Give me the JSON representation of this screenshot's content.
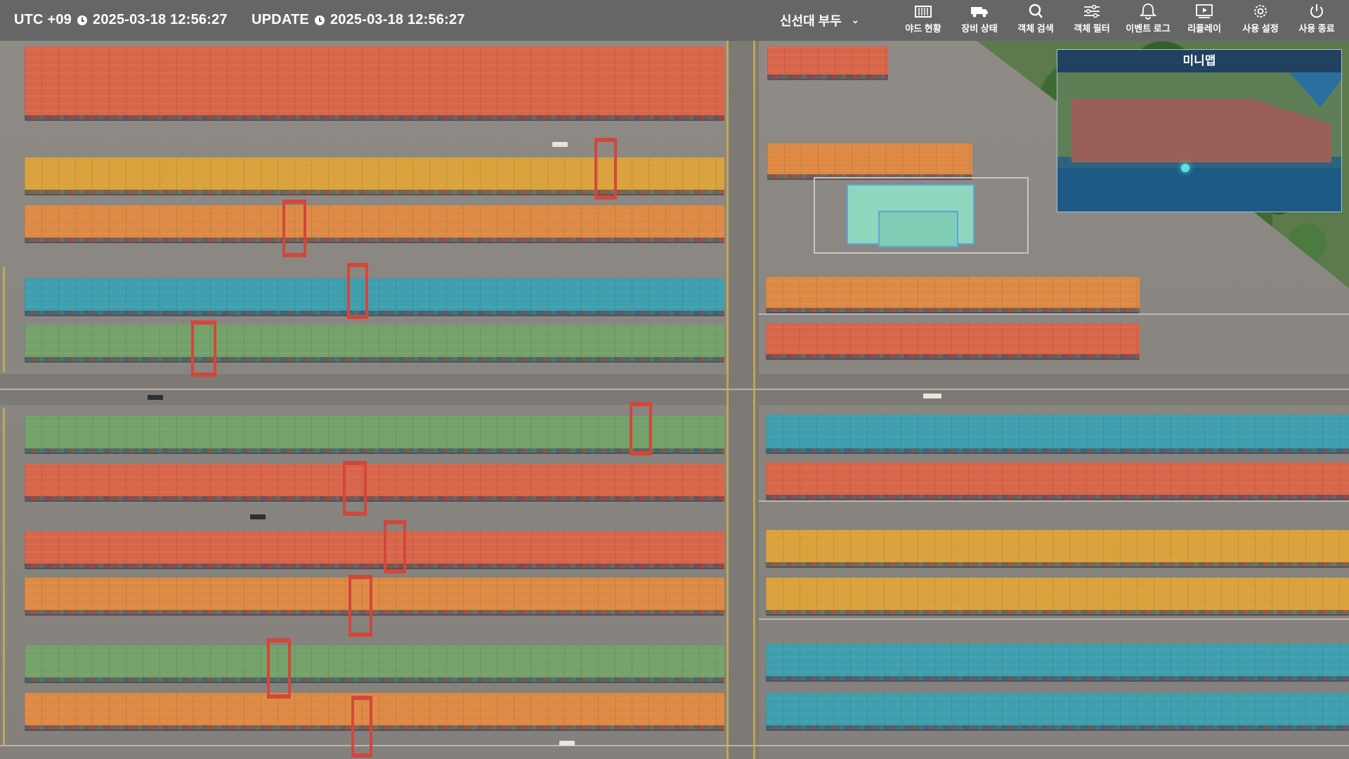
{
  "header": {
    "utc_label": "UTC +09",
    "utc_time": "2025-03-18 12:56:27",
    "update_label": "UPDATE",
    "update_time": "2025-03-18 12:56:27",
    "terminal_selected": "신선대 부두"
  },
  "nav": [
    {
      "label": "야드 현황",
      "icon": "container-icon"
    },
    {
      "label": "장비 상태",
      "icon": "truck-icon"
    },
    {
      "label": "객체 검색",
      "icon": "search-icon"
    },
    {
      "label": "객체 필터",
      "icon": "filter-sliders-icon"
    },
    {
      "label": "이벤트 로그",
      "icon": "bell-icon"
    },
    {
      "label": "리플레이",
      "icon": "replay-icon"
    },
    {
      "label": "사용 설정",
      "icon": "gear-icon"
    },
    {
      "label": "사용 종료",
      "icon": "power-icon"
    }
  ],
  "minimap": {
    "title": "미니맵"
  },
  "colors": {
    "red": "#d8664a",
    "orange": "#de8a45",
    "yellow": "#d9a23c",
    "teal": "#3f9fae",
    "green": "#74a26a",
    "crane": "#d3473a"
  }
}
